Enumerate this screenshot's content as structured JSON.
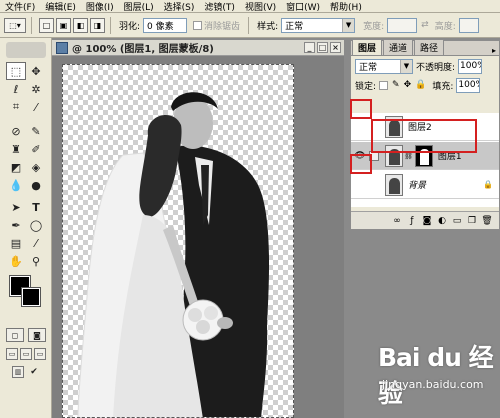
{
  "menu": [
    "文件(F)",
    "编辑(E)",
    "图像(I)",
    "图层(L)",
    "选择(S)",
    "滤镜(T)",
    "视图(V)",
    "窗口(W)",
    "帮助(H)"
  ],
  "options": {
    "feather_label": "羽化:",
    "feather_value": "0 像素",
    "antialias_label": "消除锯齿",
    "style_label": "样式:",
    "style_value": "正常",
    "width_label": "宽度:",
    "height_label": "高度:"
  },
  "document": {
    "title": "@ 100% (图层1, 图层蒙板/8)"
  },
  "layers_panel": {
    "tabs": [
      "图层",
      "通道",
      "路径"
    ],
    "blend_mode": "正常",
    "opacity_label": "不透明度:",
    "opacity_value": "100%",
    "lock_label": "锁定:",
    "fill_label": "填充:",
    "fill_value": "100%",
    "layers": [
      {
        "name": "图层2"
      },
      {
        "name": "图层1"
      },
      {
        "name": "背景"
      }
    ]
  },
  "watermark": {
    "brand": "Bai du 经验",
    "url": "jingyan.baidu.com"
  },
  "colors": {
    "highlight": "#d42020"
  }
}
